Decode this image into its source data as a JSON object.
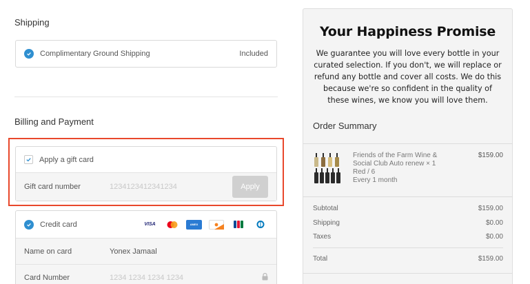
{
  "shipping": {
    "title": "Shipping",
    "method": "Complimentary Ground Shipping",
    "status": "Included"
  },
  "billing": {
    "title": "Billing and Payment",
    "gift_card": {
      "checkbox_label": "Apply a gift card",
      "checked": true,
      "field_label": "Gift card number",
      "field_value": "1234123412341234",
      "apply_label": "Apply"
    },
    "credit_card": {
      "label": "Credit card",
      "card_brands": [
        "VISA",
        "Mastercard",
        "AMEX",
        "Discover",
        "JCB",
        "Diners"
      ],
      "name_label": "Name on card",
      "name_value": "Yonex Jamaal",
      "number_label": "Card Number",
      "number_placeholder": "1234 1234 1234 1234"
    }
  },
  "promise": {
    "title": "Your Happiness Promise",
    "text": "We guarantee you will love every bottle in your curated selection. If you don't, we will replace or refund any bottle and cover all costs. We do this because we're so confident in the quality of these wines, we know you will love them."
  },
  "order_summary": {
    "title": "Order Summary",
    "item": {
      "name": "Friends of the Farm Wine & Social Club Auto renew × 1",
      "variant": "Red / 6",
      "frequency": "Every 1 month",
      "price": "$159.00"
    },
    "subtotal_label": "Subtotal",
    "subtotal": "$159.00",
    "shipping_label": "Shipping",
    "shipping": "$0.00",
    "taxes_label": "Taxes",
    "taxes": "$0.00",
    "total_label": "Total",
    "total": "$159.00"
  },
  "colors": {
    "accent": "#2f8fd0",
    "highlight": "#e8472b"
  }
}
